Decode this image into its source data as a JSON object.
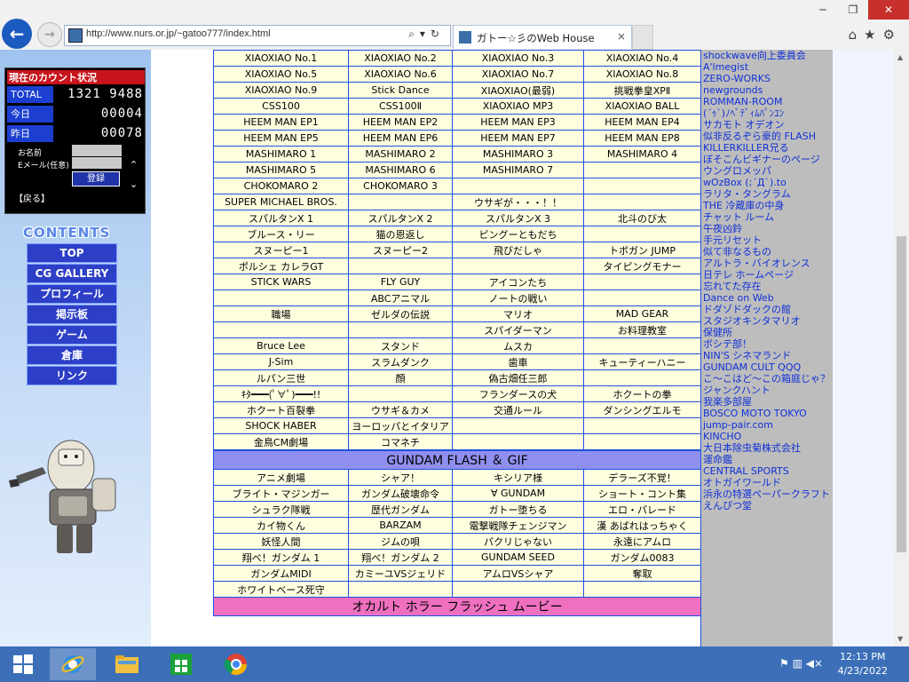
{
  "browser": {
    "url": "http://www.nurs.or.jp/~gatoo777/index.html",
    "tab_title": "ガトー☆彡のWeb House",
    "tab_close": "×",
    "back": "←",
    "forward": "→",
    "addr_tools": "⌕▾↻",
    "win_min": "─",
    "win_max": "❐",
    "win_close": "✕",
    "icons": "⌂★⚙"
  },
  "counter": {
    "title": "現在のカウント状況",
    "total_label": "TOTAL",
    "total_value": "1321 9488",
    "today_label": "今日",
    "today_value": "00004",
    "yesterday_label": "昨日",
    "yesterday_value": "00078",
    "name_label": "お名前",
    "email_label": "Eメール(任意)",
    "register": "登録",
    "back": "【戻る】"
  },
  "contents": {
    "title": "CONTENTS",
    "items": [
      "TOP",
      "CG GALLERY",
      "プロフィール",
      "掲示板",
      "ゲーム",
      "倉庫",
      "リンク"
    ]
  },
  "flash_rows": [
    [
      "XIAOXIAO No.1",
      "XIAOXIAO No.2",
      "XIAOXIAO No.3",
      "XIAOXIAO No.4"
    ],
    [
      "XIAOXIAO No.5",
      "XIAOXIAO No.6",
      "XIAOXIAO No.7",
      "XIAOXIAO No.8"
    ],
    [
      "XIAOXIAO No.9",
      "Stick Dance",
      "XIAOXIAO(最弱)",
      "挑戦拳皇XPⅡ"
    ],
    [
      "CSS100",
      "CSS100Ⅱ",
      "XIAOXIAO MP3",
      "XIAOXIAO BALL"
    ],
    [
      "HEEM MAN EP1",
      "HEEM MAN EP2",
      "HEEM MAN EP3",
      "HEEM MAN EP4"
    ],
    [
      "HEEM MAN EP5",
      "HEEM MAN EP6",
      "HEEM MAN EP7",
      "HEEM MAN EP8"
    ],
    [
      "MASHIMARO 1",
      "MASHIMARO 2",
      "MASHIMARO 3",
      "MASHIMARO 4"
    ],
    [
      "MASHIMARO 5",
      "MASHIMARO 6",
      "MASHIMARO 7",
      ""
    ],
    [
      "CHOKOMARO 2",
      "CHOKOMARO 3",
      "",
      ""
    ],
    [
      "SUPER MICHAEL BROS.",
      "",
      "ウサギが・・・！！",
      ""
    ],
    [
      "スパルタンX 1",
      "スパルタンX 2",
      "スパルタンX 3",
      "北斗のび太"
    ],
    [
      "ブルース・リー",
      "猫の恩返し",
      "ピングーともだち",
      ""
    ],
    [
      "スヌーピー1",
      "スヌーピー2",
      "飛びだしゃ",
      "トボガン JUMP"
    ],
    [
      "ポルシェ カレラGT",
      "",
      "",
      "タイピングモナー"
    ],
    [
      "STICK WARS",
      "FLY GUY",
      "アイコンたち",
      ""
    ],
    [
      "",
      "ABCアニマル",
      "ノートの戦い",
      ""
    ],
    [
      "職場",
      "ゼルダの伝説",
      "マリオ",
      "MAD GEAR"
    ],
    [
      "",
      "",
      "スパイダーマン",
      "お料理教室"
    ],
    [
      "Bruce Lee",
      "スタンド",
      "ムスカ",
      ""
    ],
    [
      "J-Sim",
      "スラムダンク",
      "歯車",
      "キューティーハニー"
    ],
    [
      "ルパン三世",
      "顔",
      "偽古畑任三郎",
      ""
    ],
    [
      "ｷﾀ━━━(ﾟ∀ﾟ)━━━!!",
      "",
      "フランダースの犬",
      "ホクートの拳"
    ],
    [
      "ホクート百裂拳",
      "ウサギ＆カメ",
      "交通ルール",
      "ダンシングエルモ"
    ],
    [
      "SHOCK HABER",
      "ヨーロッパとイタリア",
      "",
      ""
    ],
    [
      "金鳥CM劇場",
      "コマネチ",
      "",
      ""
    ]
  ],
  "gundam_header": "GUNDAM FLASH ＆ GIF",
  "gundam_rows": [
    [
      "アニメ劇場",
      "シャア！",
      "キシリア様",
      "デラーズ不覚！"
    ],
    [
      "ブライト・マジンガー",
      "ガンダム破壊命令",
      "∀ GUNDAM",
      "ショート・コント集"
    ],
    [
      "シュラク隊戦",
      "歴代ガンダム",
      "ガトー堕ちる",
      "エロ・パレード"
    ],
    [
      "カイ物くん",
      "BARZAM",
      "電撃戦隊チェンジマン",
      "漢 あばれはっちゃく"
    ],
    [
      "妖怪人間",
      "ジムの唄",
      "パクリじゃない",
      "永遠にアムロ"
    ],
    [
      "翔べ！ガンダム 1",
      "翔べ！ガンダム 2",
      "GUNDAM SEED",
      "ガンダム0083"
    ],
    [
      "ガンダムMIDI",
      "カミーユVSジェリド",
      "アムロVSシャア",
      "奪取"
    ],
    [
      "ホワイトベース死守",
      "",
      "",
      ""
    ]
  ],
  "occult_header": "オカルト ホラー フラッシュ ムービー",
  "links": [
    "shockwave向上委員会",
    "A'lmegist",
    "ZERO-WORKS",
    "newgrounds",
    "ROMMAN-ROOM",
    "(´ｩ`)ﾉﾍﾞﾃﾞｨﾑﾊﾟﾝﾕﾝ",
    "サカモト オデオン",
    "似非反るぞら豪的 FLASH",
    "KILLERKILLER兄る",
    "ぼそこんビギナーのページ",
    "ウングロメッパ",
    "wOzBox (;´Д`).to",
    "ラリタ・タングラム",
    "THE 冷蔵庫の中身",
    "チャット ルーム",
    "午夜凶鈴",
    "手元リセット",
    "似て非なるもの",
    "アルトラ・バイオレンス",
    "日テレ ホームページ",
    "忘れてた存在",
    "Dance on Web",
    "ドダゾドダックの館",
    "スタジオキンタマリオ",
    "保健所",
    "ボシテ部！",
    "NIN'S シネマランド",
    "GUNDAM CULT QQQ",
    "こ～こはど～この箱庭じゃ？",
    "ジャンクハント",
    "我楽多部屋",
    "BOSCO MOTO TOKYO",
    "jump-pair.com",
    "KINCHO",
    "大日本除虫菊株式会社",
    "運命鑑",
    "CENTRAL SPORTS",
    "オトガイワールド",
    "浜永の特選ペーパークラフト",
    "えんぴつ堂"
  ],
  "taskbar": {
    "time": "12:13 PM",
    "date": "4/23/2022",
    "tray_icons": "⚑ ▥ ◀×"
  }
}
